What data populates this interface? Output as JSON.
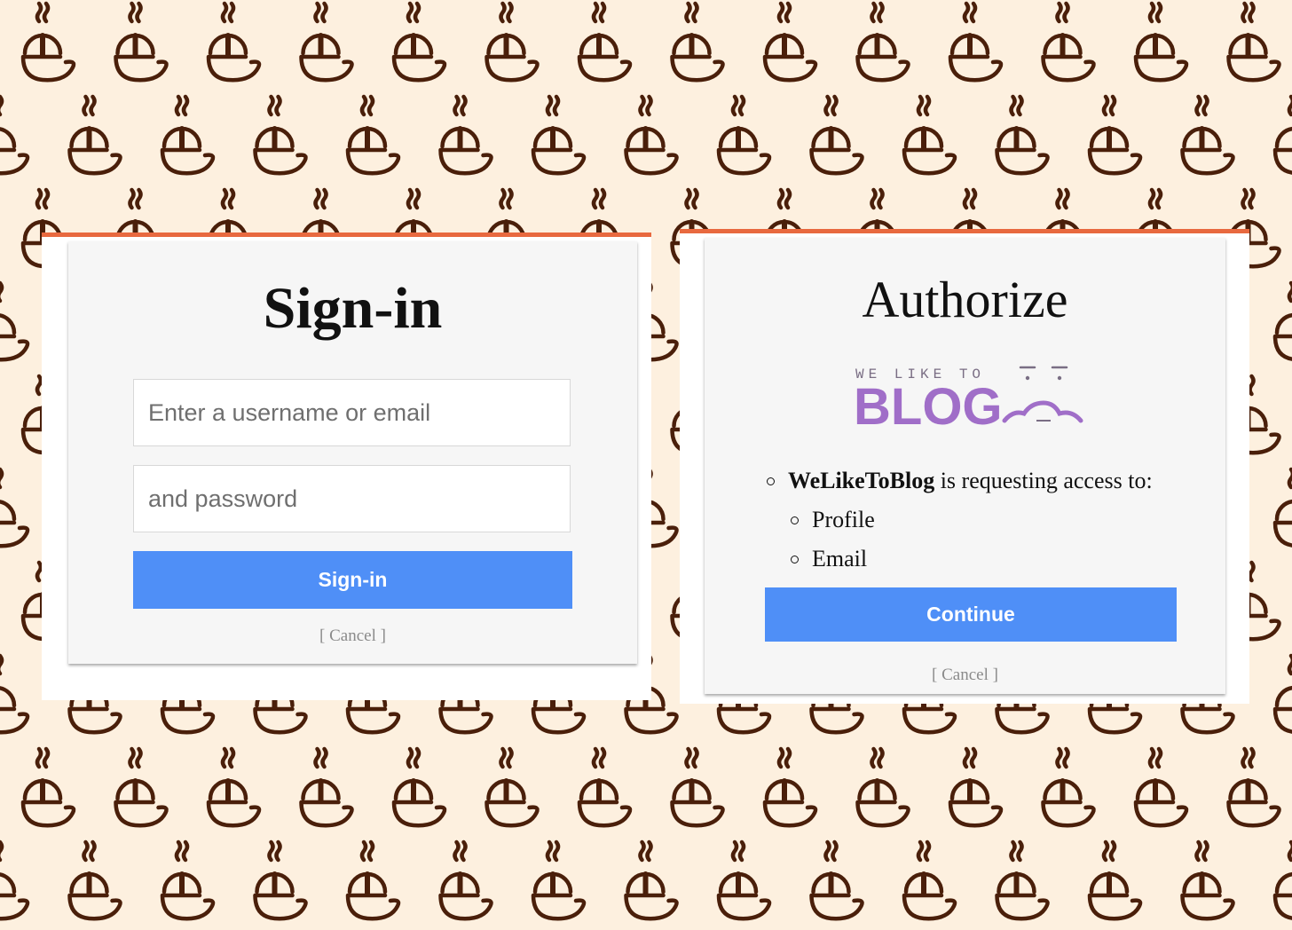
{
  "colors": {
    "background": "#fdf0df",
    "pattern": "#4a1f0a",
    "accent_line": "#e8693f",
    "button": "#4f8ff7",
    "logo_purple": "#a06ec8"
  },
  "background_icon": "coffee-cup-icon",
  "signin": {
    "title": "Sign-in",
    "username_placeholder": "Enter a username or email",
    "password_placeholder": "and password",
    "button_label": "Sign-in",
    "cancel_label": "[ Cancel ]"
  },
  "authorize": {
    "title": "Authorize",
    "logo": {
      "small_text": "WE LIKE TO",
      "big_text": "BLOG"
    },
    "app_name": "WeLikeToBlog",
    "request_text": " is requesting access to:",
    "scopes": [
      "Profile",
      "Email"
    ],
    "button_label": "Continue",
    "cancel_label": "[ Cancel ]"
  }
}
